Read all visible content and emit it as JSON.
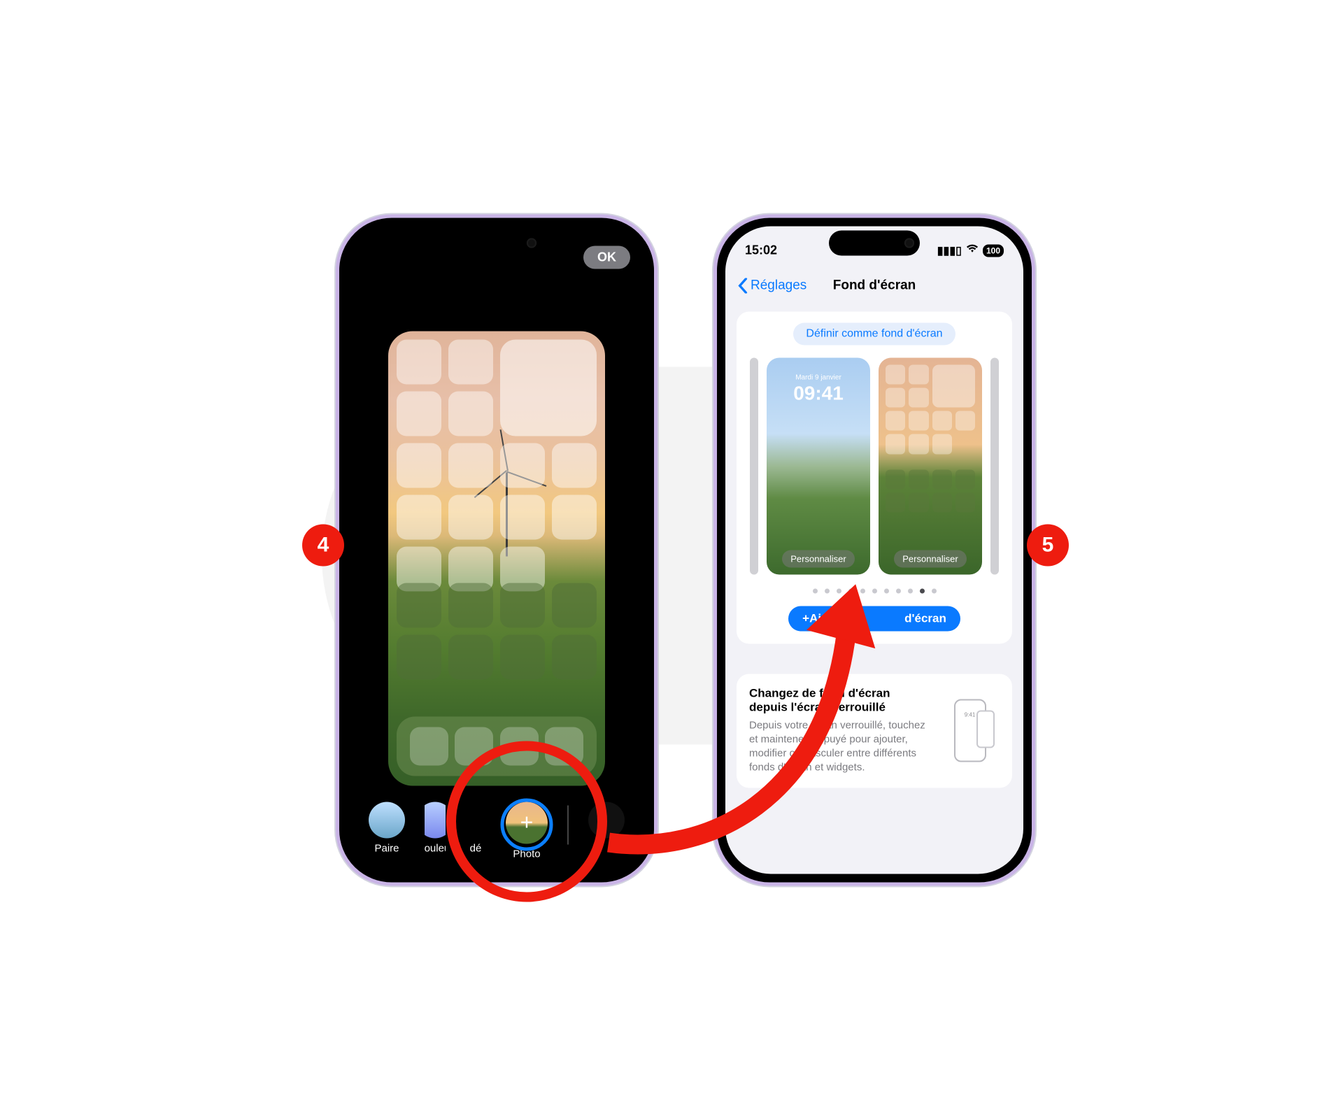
{
  "step_left": "4",
  "step_right": "5",
  "left_phone": {
    "ok": "OK",
    "options": {
      "paire": "Paire",
      "couleur": "Couleur",
      "degrade_truncated": "dé",
      "photo": "Photo",
      "plus": "+"
    }
  },
  "right_phone": {
    "status": {
      "time": "15:02",
      "battery": "100"
    },
    "nav": {
      "back": "Réglages",
      "title": "Fond d'écran"
    },
    "define_pill": "Définir comme fond d'écran",
    "lock_thumb": {
      "day": "Mardi 9 janvier",
      "time": "09:41"
    },
    "customize": "Personnaliser",
    "add_button_left": "+Ajoute",
    "add_button_right": "d'écran",
    "info": {
      "title": "Changez de fond d'écran depuis l'écran verrouillé",
      "body_l1": "Depuis votre écran verrouillé,",
      "body_l2": "touchez et maintenez appuyé pour",
      "body_l3": "ajouter, modifier ou basculer entre",
      "body_l4": "différents fonds d'écran et",
      "body_l5": "widgets."
    },
    "pager_active_index": 9
  }
}
